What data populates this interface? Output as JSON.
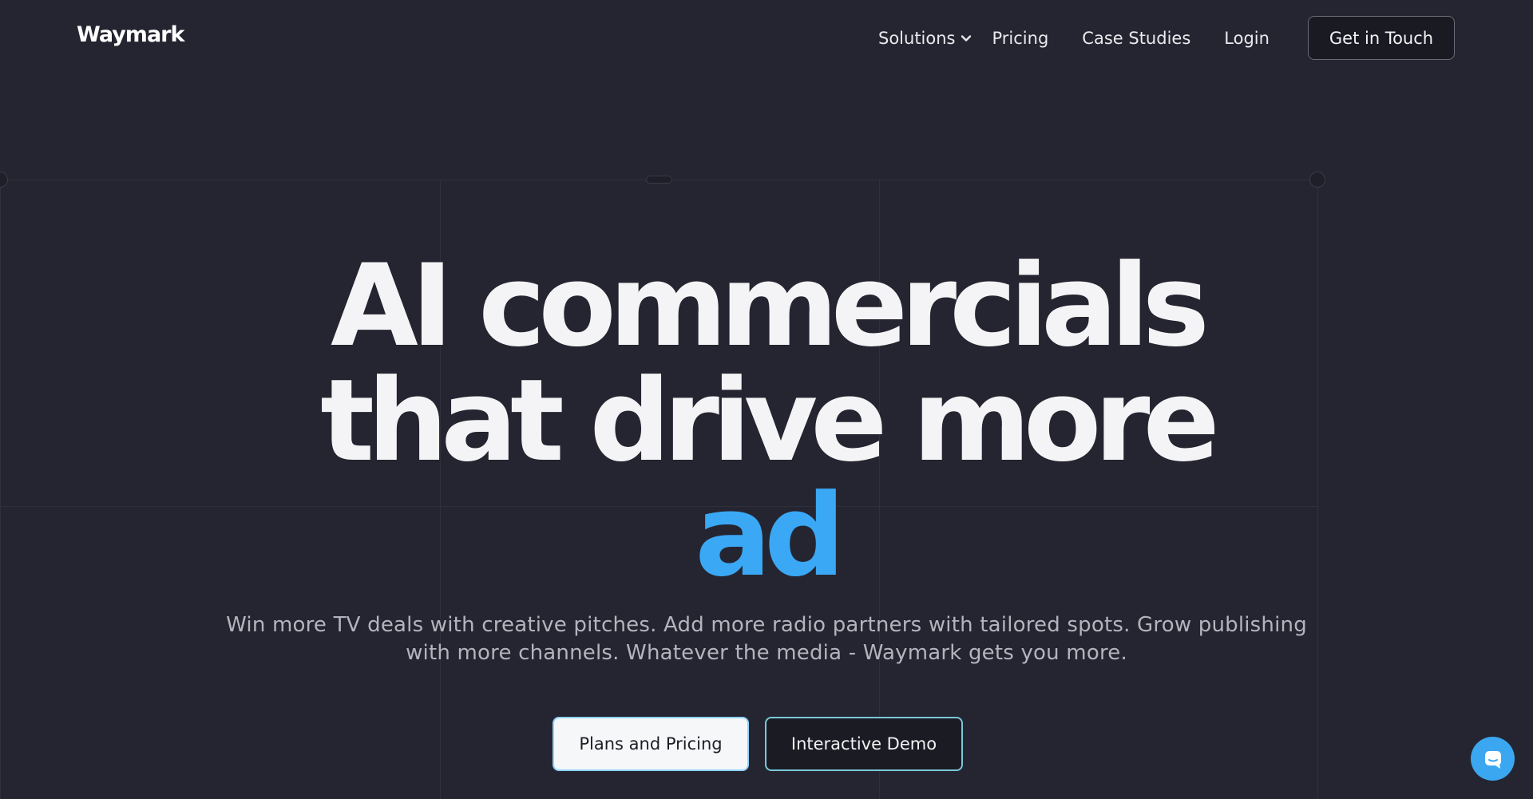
{
  "brand": {
    "logo_text": "Waymark"
  },
  "nav": {
    "items": [
      {
        "label": "Solutions"
      },
      {
        "label": "Pricing"
      },
      {
        "label": "Case Studies"
      },
      {
        "label": "Login"
      }
    ],
    "cta_label": "Get in Touch"
  },
  "hero": {
    "title_line1": "AI commercials",
    "title_line2": "that drive more",
    "title_accent": "ad",
    "subtitle_line1": "Win more TV deals with creative pitches. Add more radio partners with tailored spots. Grow publishing",
    "subtitle_line2": "with more channels. Whatever the media - Waymark gets you more.",
    "primary_button": "Plans and Pricing",
    "secondary_button": "Interactive Demo"
  },
  "icons": {
    "solutions_dropdown": "chevron-down-icon",
    "chat": "chat-bubble-icon"
  },
  "colors": {
    "background": "#252531",
    "accent": "#3aa8f5",
    "chat_button": "#3ba7f1"
  }
}
